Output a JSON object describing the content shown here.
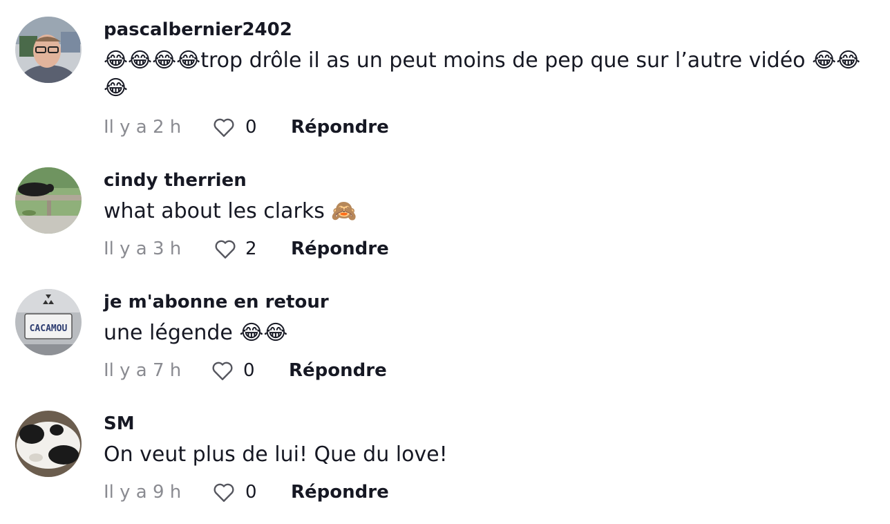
{
  "comments": [
    {
      "username": "pascalbernier2402",
      "text": "😂😂😂😂trop drôle il as un peut moins de pep que sur l’autre vidéo 😂😂😂",
      "time": "Il y a 2 h",
      "likes": "0",
      "reply_label": "Répondre",
      "avatar_icon": "man-with-glasses-photo"
    },
    {
      "username": "cindy therrien",
      "text": "what about les clarks 🙈",
      "time": "Il y a 3 h",
      "likes": "2",
      "reply_label": "Répondre",
      "avatar_icon": "bear-on-rail-photo"
    },
    {
      "username": "je m'abonne en retour",
      "text": "une légende 😂😂",
      "time": "Il y a 7 h",
      "likes": "0",
      "reply_label": "Répondre",
      "avatar_icon": "license-plate-photo",
      "avatar_plate": "CACAMOU"
    },
    {
      "username": "SM",
      "text": "On veut plus de lui! Que du love!",
      "time": "Il y a 9 h",
      "likes": "0",
      "reply_label": "Répondre",
      "avatar_icon": "cat-photo"
    }
  ],
  "colors": {
    "primary_text": "#161823",
    "secondary_text": "#8a8b91",
    "background": "#ffffff"
  }
}
